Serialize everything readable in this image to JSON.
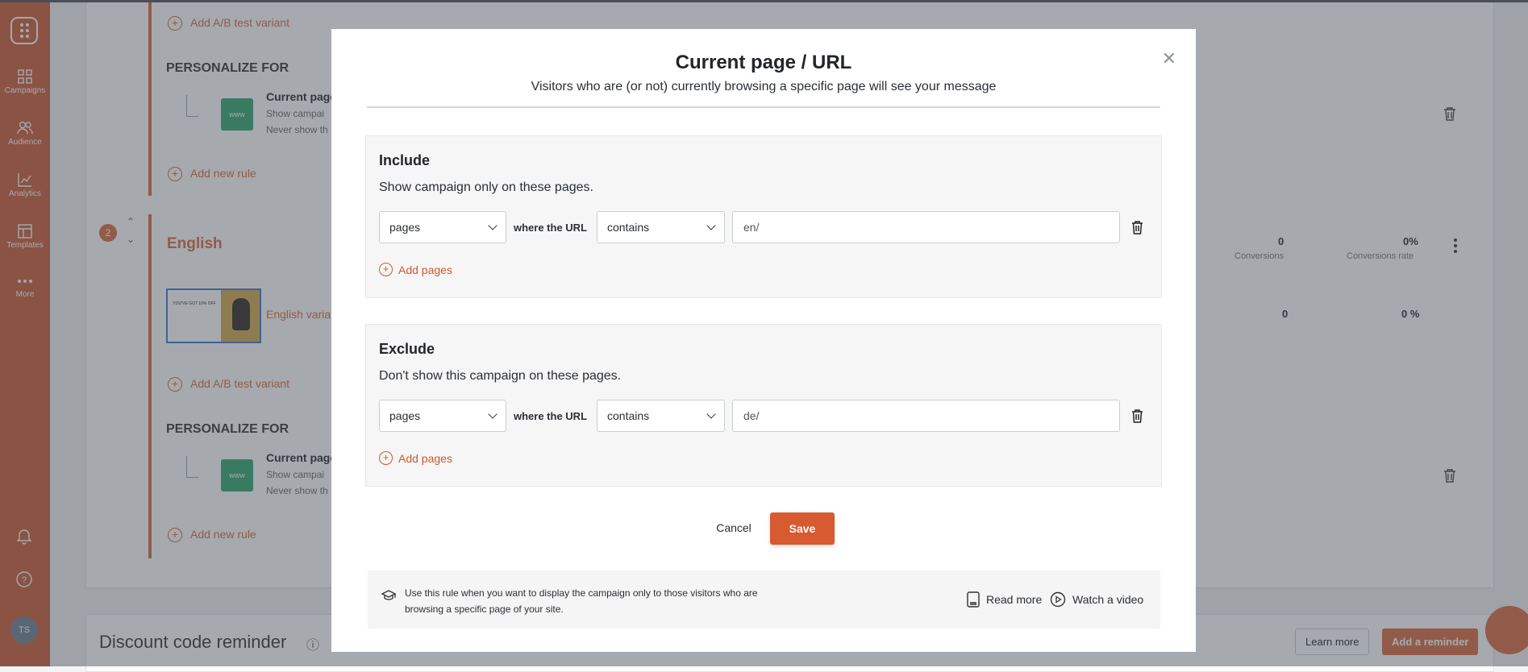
{
  "sidebar": {
    "items": [
      {
        "label": "Campaigns",
        "icon": "grid-icon"
      },
      {
        "label": "Audience",
        "icon": "users-icon"
      },
      {
        "label": "Analytics",
        "icon": "chart-icon"
      },
      {
        "label": "Templates",
        "icon": "layout-icon"
      },
      {
        "label": "More",
        "icon": "dots-icon"
      }
    ],
    "avatar_initials": "TS"
  },
  "background": {
    "add_ab_variant": "Add A/B test variant",
    "personalize_for": "PERSONALIZE FOR",
    "rule_title": "Current page",
    "rule_line1": "Show campai",
    "rule_line2": "Never show th",
    "add_new_rule": "Add new rule",
    "variant_number": "2",
    "variant_name": "English",
    "variant_row_name": "English variant",
    "thumb_text": "YOU'VE GOT 10% OFF",
    "www_label": "www",
    "conversions_value": "0",
    "conversions_label": "Conversions",
    "conversions_rate_value": "0%",
    "conversions_rate_label": "Conversions rate",
    "row_conversions": "0",
    "row_rate": "0 %",
    "discount_title": "Discount code reminder",
    "learn_more": "Learn more",
    "add_reminder": "Add a reminder"
  },
  "modal": {
    "title": "Current page / URL",
    "subtitle": "Visitors who are (or not) currently browsing a specific page will see your message",
    "include": {
      "title": "Include",
      "description": "Show campaign only on these pages.",
      "scope_value": "pages",
      "where_label": "where the URL",
      "operator_value": "contains",
      "url_value": "en/",
      "add_pages": "Add pages"
    },
    "exclude": {
      "title": "Exclude",
      "description": "Don't show this campaign on these pages.",
      "scope_value": "pages",
      "where_label": "where the URL",
      "operator_value": "contains",
      "url_value": "de/",
      "add_pages": "Add pages"
    },
    "cancel_label": "Cancel",
    "save_label": "Save",
    "info": {
      "text": "Use this rule when you want to display the campaign only to those visitors who are browsing a specific page of your site.",
      "read_more": "Read more",
      "watch_video": "Watch a video"
    }
  },
  "colors": {
    "brand": "#d85a31",
    "sidebar": "#ca5a37"
  }
}
